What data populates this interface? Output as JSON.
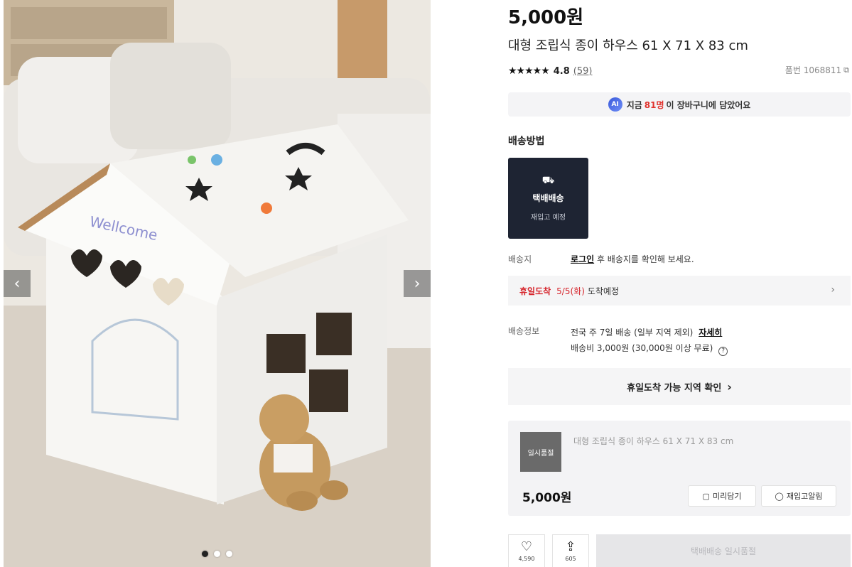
{
  "gallery": {
    "image_text": "Wellcome",
    "prev_icon": "chevron-left-icon",
    "next_icon": "chevron-right-icon",
    "prev_glyph": "‹",
    "next_glyph": "›",
    "dots": 3,
    "active_dot": 0
  },
  "product": {
    "price": "5,000원",
    "title": "대형 조립식 종이 하우스 61 X 71 X 83 cm",
    "stars": "★★★★★",
    "rating": "4.8",
    "review_count": "(59)",
    "product_code": "품번 1068811",
    "copy_glyph": "⧉"
  },
  "cart_banner": {
    "ai_label": "AI",
    "prefix": "지금",
    "count": "81명",
    "suffix": "이 장바구니에 담았어요"
  },
  "shipping": {
    "heading": "배송방법",
    "truck_glyph": "⛟",
    "card_title": "택배배송",
    "card_sub": "재입고 예정",
    "address_label": "배송지",
    "login_link": "로그인",
    "address_text": "후 배송지를 확인해 보세요.",
    "holiday_label": "휴일도착",
    "holiday_date": "5/5(화)",
    "holiday_suffix": "도착예정",
    "info_label": "배송정보",
    "info_line1": "전국 주 7일 배송 (일부 지역 제외)",
    "detail_link": "자세히",
    "info_line2": "배송비 3,000원 (30,000원 이상 무료)",
    "help_glyph": "?",
    "area_button": "휴일도착 가능 지역 확인",
    "chevron": "›"
  },
  "option": {
    "thumb_label": "일시품절",
    "title": "대형 조립식 종이 하우스 61 X 71 X 83 cm",
    "price": "5,000원",
    "wish_button": "미리담기",
    "notify_button": "재입고알림"
  },
  "bottom": {
    "heart_glyph": "♡",
    "like_count": "4,590",
    "share_glyph": "⇪",
    "share_count": "605",
    "soldout_label": "택배배송 일시품절"
  }
}
